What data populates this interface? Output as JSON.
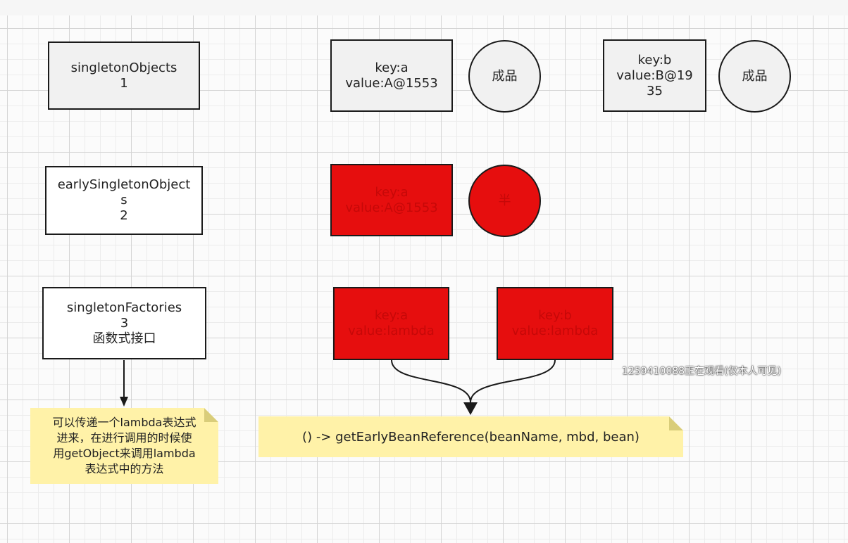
{
  "caches": {
    "singleton_objects": {
      "name": "singletonObjects",
      "level": "1"
    },
    "early_singleton_objects": {
      "name_line1": "earlySingletonObject",
      "name_line2": "s",
      "level": "2"
    },
    "singleton_factories": {
      "name": "singletonFactories",
      "level": "3",
      "description": "函数式接口"
    }
  },
  "level1": {
    "entry_a": {
      "key": "key:a",
      "value": "value:A@1553",
      "status": "成品"
    },
    "entry_b": {
      "key": "key:b",
      "value_line1": "value:B@19",
      "value_line2": "35",
      "status": "成品"
    }
  },
  "level2": {
    "entry_a": {
      "key": "key:a",
      "value": "value:A@1553",
      "status": "半"
    }
  },
  "level3": {
    "entry_a": {
      "key": "key:a",
      "value": "value:lambda"
    },
    "entry_b": {
      "key": "key:b",
      "value": "value:lambda"
    }
  },
  "notes": {
    "left_lines": [
      "可以传递一个lambda表达式",
      "进来，在进行调用的时候使",
      "用getObject来调用lambda",
      "表达式中的方法"
    ],
    "bottom": "() -> getEarlyBeanReference(beanName, mbd, bean)"
  },
  "watermark": "1259410088正在观看(仅本人可见)",
  "colors": {
    "red_fill": "#e60e0e",
    "note_fill": "#fff2a8",
    "border": "#1a1a1a"
  }
}
